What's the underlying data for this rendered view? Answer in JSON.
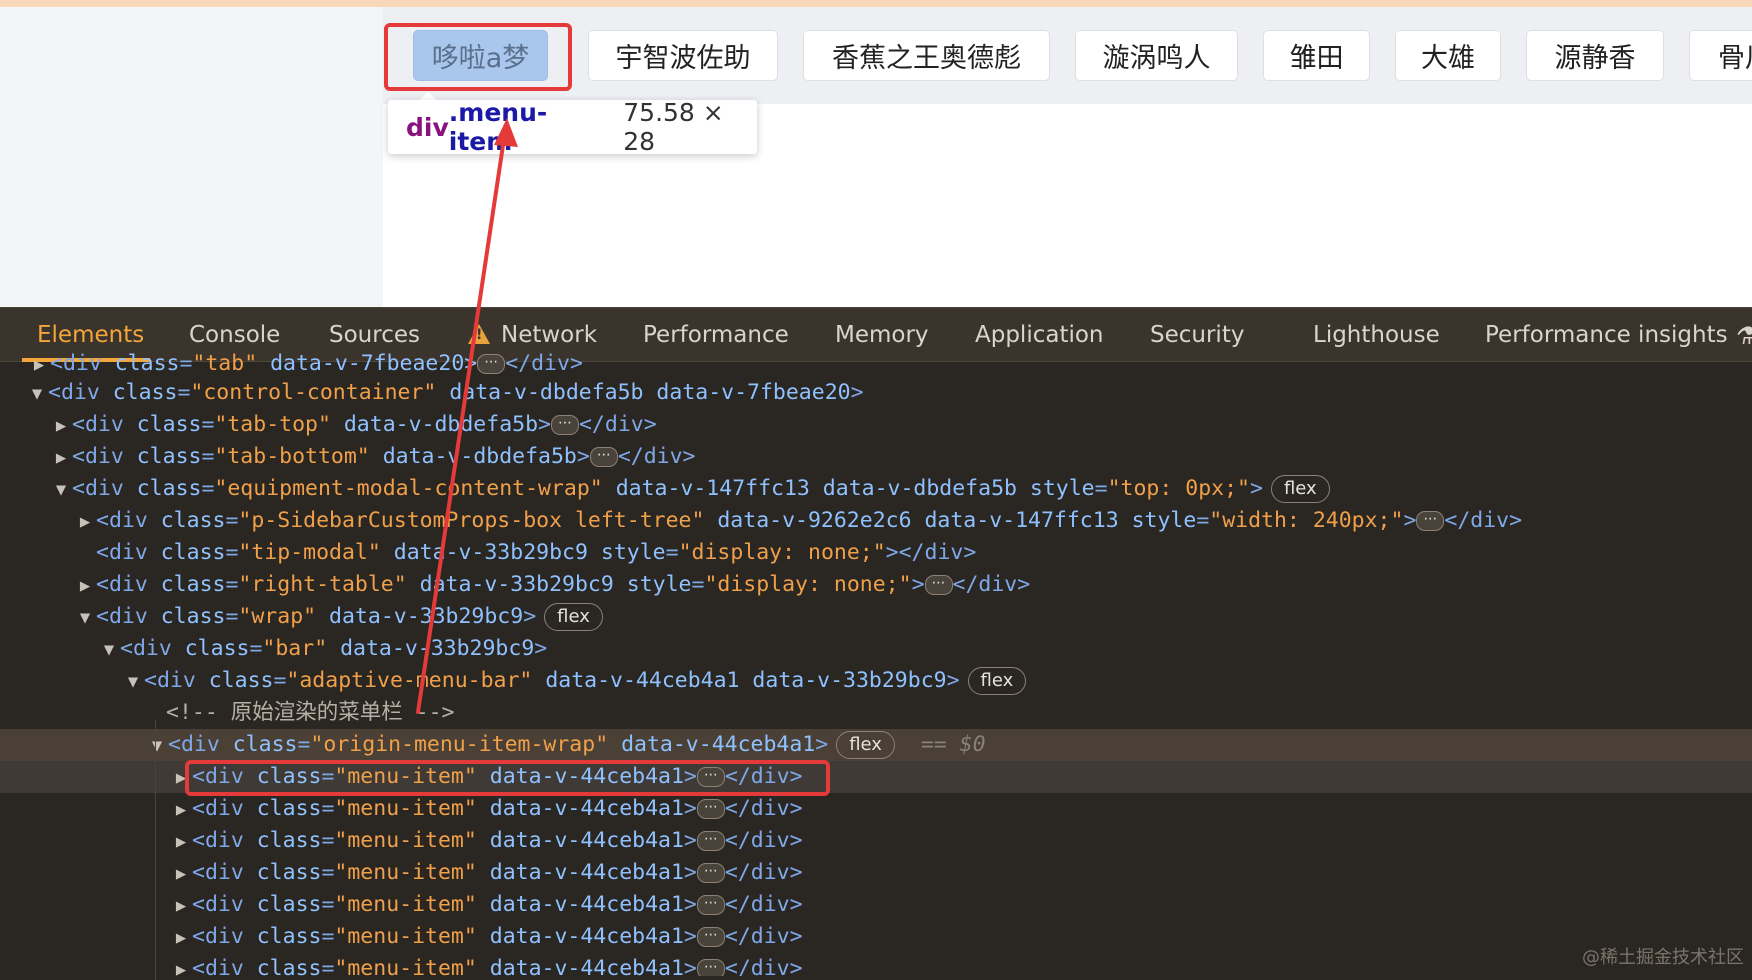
{
  "menu_bar": {
    "items": [
      "哆啦a梦",
      "宇智波佐助",
      "香蕉之王奥德彪",
      "漩涡鸣人",
      "雏田",
      "大雄",
      "源静香",
      "骨川"
    ]
  },
  "tooltip": {
    "tag": "div",
    "class": ".menu-item",
    "size": "75.58 × 28"
  },
  "devtools": {
    "tabs": [
      "Elements",
      "Console",
      "Sources",
      "Network",
      "Performance",
      "Memory",
      "Application",
      "Security",
      "Lighthouse",
      "Performance insights"
    ],
    "active_tab": "Elements",
    "dom": {
      "r0": {
        "open": "<div ",
        "a1": "class",
        "eq1": "=",
        "v1": "\"tab\"",
        "rest": " data-v-7fbeae20>",
        "close": "</div>"
      },
      "r1": {
        "open": "<div ",
        "a1": "class",
        "eq1": "=",
        "v1": "\"control-container\"",
        "a2": " data-v-dbdefa5b data-v-7fbeae20",
        "end": ">"
      },
      "r2": {
        "open": "<div ",
        "a1": "class",
        "eq1": "=",
        "v1": "\"tab-top\"",
        "a2": " data-v-dbdefa5b",
        "end": ">",
        "close": "</div>"
      },
      "r3": {
        "open": "<div ",
        "a1": "class",
        "eq1": "=",
        "v1": "\"tab-bottom\"",
        "a2": " data-v-dbdefa5b",
        "end": ">",
        "close": "</div>"
      },
      "r4": {
        "open": "<div ",
        "a1": "class",
        "eq1": "=",
        "v1": "\"equipment-modal-content-wrap\"",
        "a2": " data-v-147ffc13 data-v-dbdefa5b ",
        "a3": "style",
        "eq3": "=",
        "v3": "\"top: 0px;\"",
        "end": ">",
        "pill": "flex"
      },
      "r5": {
        "open": "<div ",
        "a1": "class",
        "eq1": "=",
        "v1": "\"p-SidebarCustomProps-box left-tree\"",
        "a2": " data-v-9262e2c6 data-v-147ffc13 ",
        "a3": "style",
        "eq3": "=",
        "v3": "\"width: 240px;\"",
        "end": ">",
        "close": "</div>"
      },
      "r6": {
        "open": "<div ",
        "a1": "class",
        "eq1": "=",
        "v1": "\"tip-modal\"",
        "a2": " data-v-33b29bc9 ",
        "a3": "style",
        "eq3": "=",
        "v3": "\"display: none;\"",
        "end": "></div>"
      },
      "r7": {
        "open": "<div ",
        "a1": "class",
        "eq1": "=",
        "v1": "\"right-table\"",
        "a2": " data-v-33b29bc9 ",
        "a3": "style",
        "eq3": "=",
        "v3": "\"display: none;\"",
        "end": ">",
        "close": "</div>"
      },
      "r8": {
        "open": "<div ",
        "a1": "class",
        "eq1": "=",
        "v1": "\"wrap\"",
        "a2": " data-v-33b29bc9",
        "end": ">",
        "pill": "flex"
      },
      "r9": {
        "open": "<div ",
        "a1": "class",
        "eq1": "=",
        "v1": "\"bar\"",
        "a2": " data-v-33b29bc9",
        "end": ">"
      },
      "r10": {
        "open": "<div ",
        "a1": "class",
        "eq1": "=",
        "v1": "\"adaptive-menu-bar\"",
        "a2": " data-v-44ceb4a1 data-v-33b29bc9",
        "end": ">",
        "pill": "flex"
      },
      "r11": {
        "comment": "<!-- 原始渲染的菜单栏 -->"
      },
      "r12": {
        "open": "<div ",
        "a1": "class",
        "eq1": "=",
        "v1": "\"origin-menu-item-wrap\"",
        "a2": " data-v-44ceb4a1",
        "end": ">",
        "pill": "flex",
        "sel": "== $0"
      },
      "menu_item_row": {
        "open": "<div ",
        "a1": "class",
        "eq1": "=",
        "v1": "\"menu-item\"",
        "a2": " data-v-44ceb4a1",
        "end": ">",
        "close": "</div>"
      }
    }
  },
  "watermark": "@稀土掘金技术社区",
  "colors": {
    "highlight_red": "#e53a3a",
    "tab_active": "#f3a63a",
    "menu_highlight": "#a9c7ec"
  }
}
